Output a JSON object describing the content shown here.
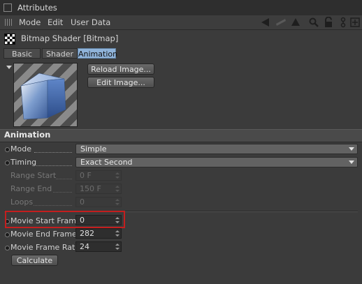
{
  "window": {
    "title": "Attributes"
  },
  "menubar": {
    "items": [
      "Mode",
      "Edit",
      "User Data"
    ]
  },
  "toolbar_icons": [
    "back-arrow-icon",
    "forward-arrow-icon",
    "up-arrow-icon",
    "search-icon",
    "lock-icon",
    "node-icon",
    "add-panel-icon"
  ],
  "object": {
    "title": "Bitmap Shader [Bitmap]"
  },
  "tabs": [
    {
      "label": "Basic",
      "active": false
    },
    {
      "label": "Shader",
      "active": false
    },
    {
      "label": "Animation",
      "active": true
    }
  ],
  "preview_buttons": {
    "reload": "Reload Image...",
    "edit": "Edit Image..."
  },
  "section": {
    "title": "Animation"
  },
  "params": {
    "mode": {
      "label": "Mode",
      "value": "Simple"
    },
    "timing": {
      "label": "Timing",
      "value": "Exact Second"
    },
    "range_start": {
      "label": "Range Start",
      "value": "0 F"
    },
    "range_end": {
      "label": "Range End",
      "value": "150 F"
    },
    "loops": {
      "label": "Loops",
      "value": "0"
    },
    "movie_start_frame": {
      "label": "Movie Start Frame",
      "value": "0"
    },
    "movie_end_frame": {
      "label": "Movie End Frame",
      "value": "282"
    },
    "movie_frame_rate": {
      "label": "Movie Frame Rate",
      "value": "24"
    }
  },
  "calculate_button": "Calculate",
  "colors": {
    "active_tab": "#8fb3d9",
    "highlight": "#c41e1e",
    "background": "#3b3b3b"
  }
}
